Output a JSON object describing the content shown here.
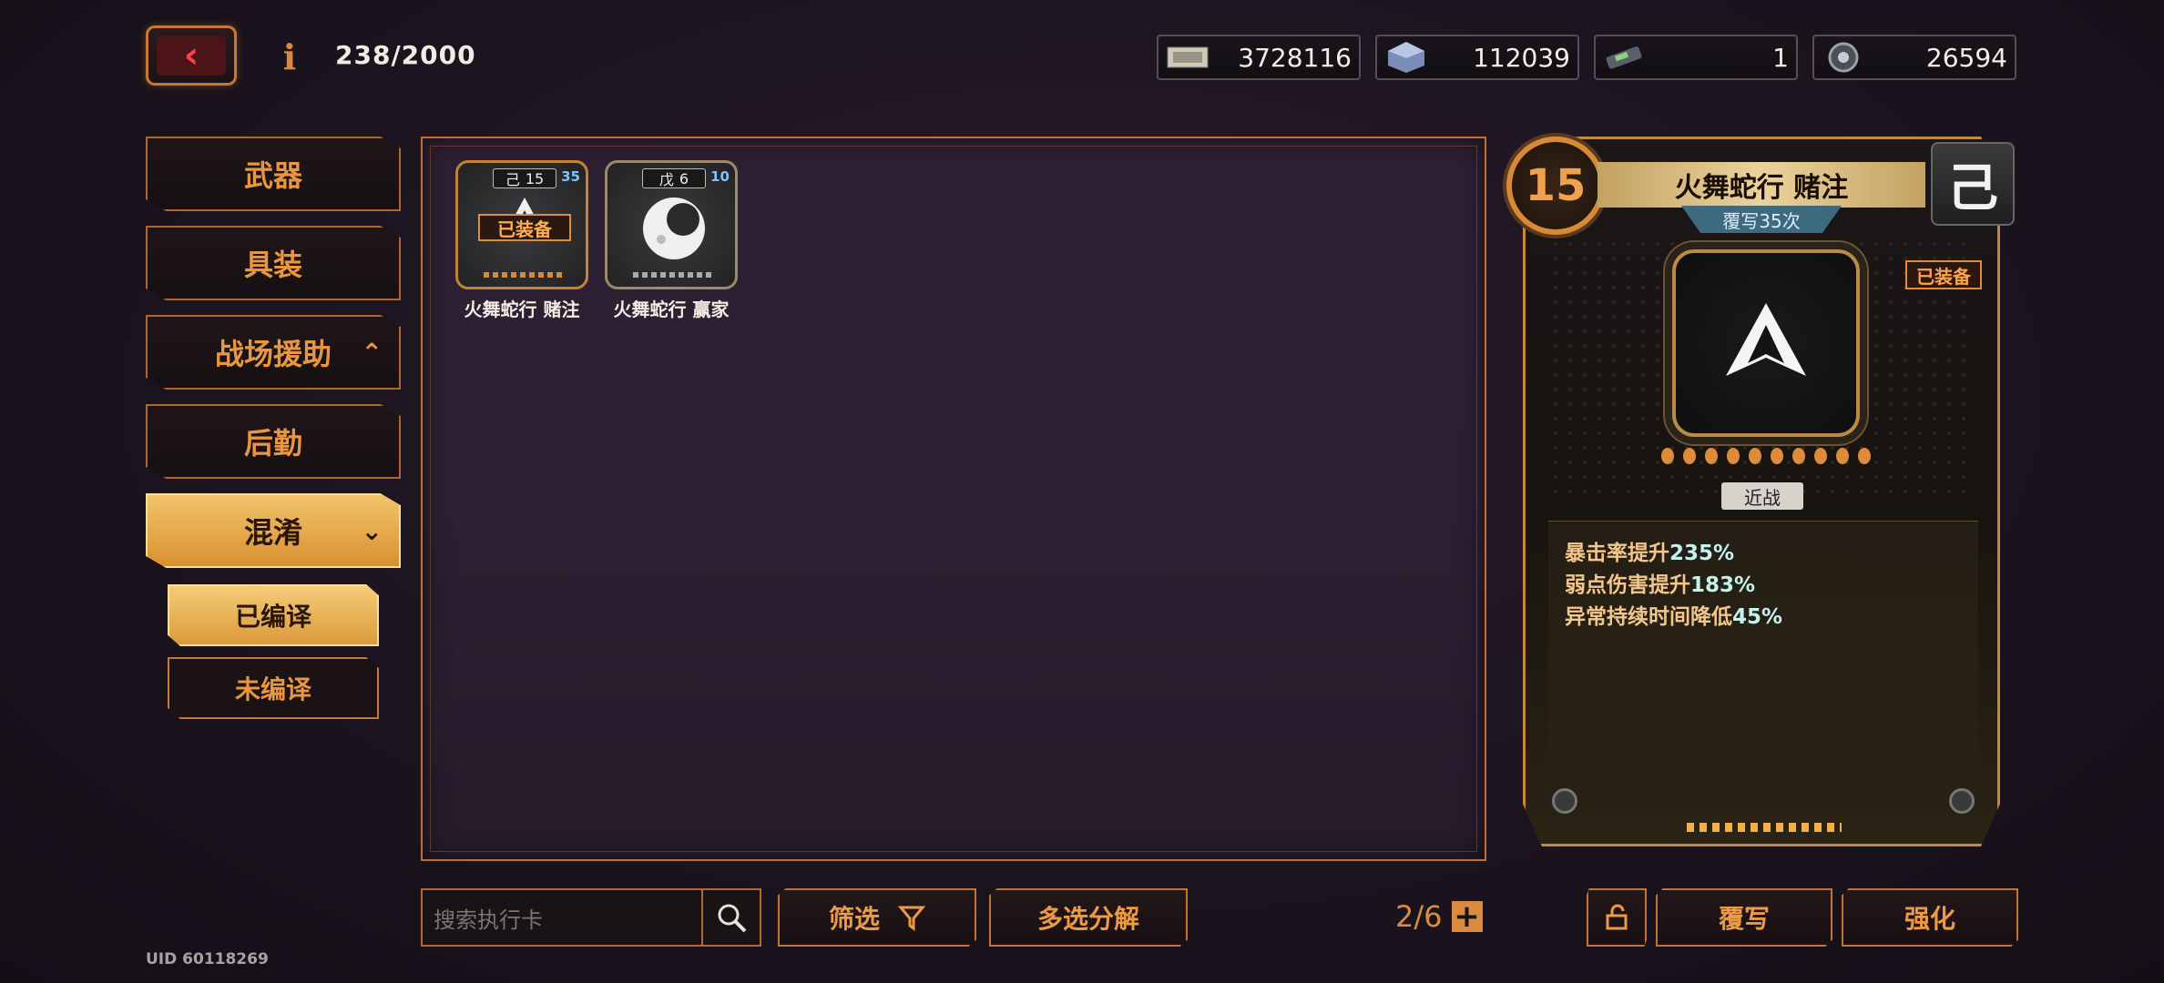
{
  "header": {
    "capacity": "238/2000",
    "currencies": [
      {
        "icon": "cash-icon",
        "value": "3728116"
      },
      {
        "icon": "data-cube-icon",
        "value": "112039"
      },
      {
        "icon": "chip-icon",
        "value": "1"
      },
      {
        "icon": "gear-core-icon",
        "value": "26594"
      }
    ]
  },
  "menu": {
    "items": [
      {
        "label": "武器"
      },
      {
        "label": "具装"
      },
      {
        "label": "战场援助"
      },
      {
        "label": "后勤"
      },
      {
        "label": "混淆"
      }
    ],
    "sub_items": [
      {
        "label": "已编译"
      },
      {
        "label": "未编译"
      }
    ]
  },
  "cards": [
    {
      "name": "火舞蛇行 赌注",
      "slot": "己",
      "level": "15",
      "plus": "35",
      "equipped_label": "已装备"
    },
    {
      "name": "火舞蛇行 赢家",
      "slot": "戊",
      "level": "6",
      "plus": "10"
    }
  ],
  "detail": {
    "level": "15",
    "title": "火舞蛇行 赌注",
    "rewrite_count": "覆写35次",
    "slot_glyph": "己",
    "equipped_label": "已装备",
    "type": "近战",
    "pip_count": 10,
    "stats": [
      {
        "label": "暴击率提升",
        "value": "235%"
      },
      {
        "label": "弱点伤害提升",
        "value": "183%"
      },
      {
        "label": "异常持续时间降低",
        "value": "45%"
      }
    ]
  },
  "bottom": {
    "search_placeholder": "搜索执行卡",
    "filter_label": "筛选",
    "bulk_label": "多选分解",
    "page": "2/6",
    "rewrite_label": "覆写",
    "enhance_label": "强化",
    "uid": "UID 60118269"
  },
  "colors": {
    "accent": "#e9963f",
    "highlight": "#f2c46c",
    "stat_value": "#c4f2ec"
  }
}
